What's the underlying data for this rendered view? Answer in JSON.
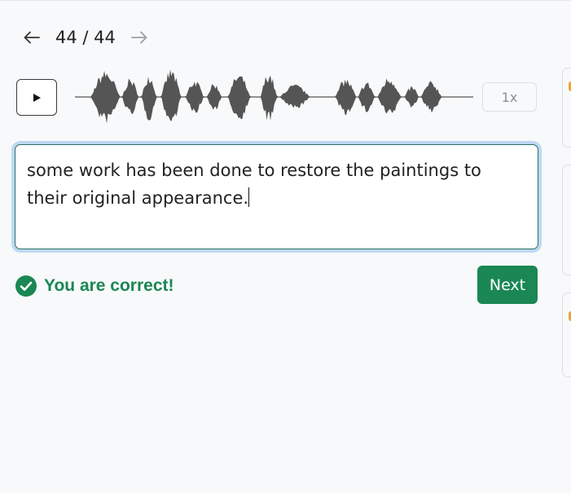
{
  "navigation": {
    "prev_icon": "arrow-left-icon",
    "next_icon": "arrow-right-icon",
    "counter": "44 / 44"
  },
  "player": {
    "play_icon": "play-icon",
    "speed_label": "1x"
  },
  "answer": {
    "text": "some work has been done to restore the paintings to their original appearance."
  },
  "result": {
    "icon": "check-circle-icon",
    "message": "You are correct!"
  },
  "actions": {
    "next_label": "Next"
  },
  "colors": {
    "success": "#1a8754",
    "waveform": "#555555",
    "focus_ring": "#bcd8f3"
  }
}
